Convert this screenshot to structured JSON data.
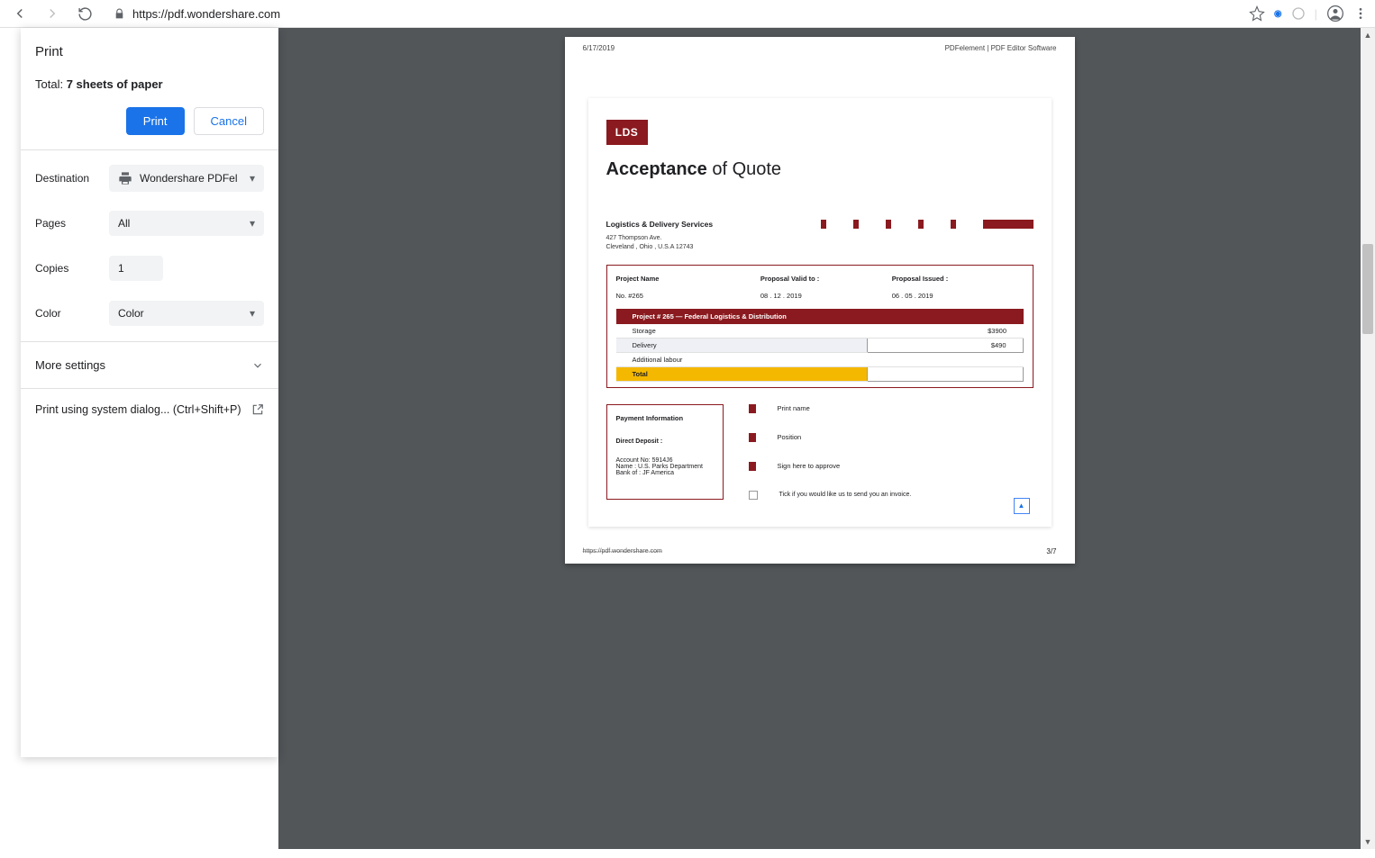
{
  "chrome": {
    "url": "https://pdf.wondershare.com"
  },
  "print": {
    "title": "Print",
    "total_prefix": "Total: ",
    "total_value": "7 sheets of paper",
    "btn_print": "Print",
    "btn_cancel": "Cancel",
    "destination_label": "Destination",
    "destination_value": "Wondershare PDFel",
    "pages_label": "Pages",
    "pages_value": "All",
    "copies_label": "Copies",
    "copies_value": "1",
    "color_label": "Color",
    "color_value": "Color",
    "more_settings": "More settings",
    "system_dialog": "Print using system dialog... (Ctrl+Shift+P)"
  },
  "doc": {
    "header_date": "6/17/2019",
    "header_title": "PDFelement | PDF Editor Software",
    "logo": "LDS",
    "title_bold": "Acceptance",
    "title_rest": " of Quote",
    "company": "Logistics & Delivery Services",
    "addr1": "427 Thompson Ave.",
    "addr2": "Cleveland , Ohio , U.S.A 12743",
    "project_name_label": "Project Name",
    "project_no": "No. #265",
    "valid_label": "Proposal Valid to :",
    "valid_val": "08 . 12 . 2019",
    "issued_label": "Proposal Issued :",
    "issued_val": "06 . 05 . 2019",
    "project_bar": "Project # 265 — Federal Logistics & Distribution",
    "items": {
      "storage_label": "Storage",
      "storage_amt": "$3900",
      "delivery_label": "Delivery",
      "delivery_amt": "$490",
      "labour_label": "Additional labour",
      "total_label": "Total"
    },
    "pay": {
      "title": "Payment Information",
      "dd": "Direct Deposit :",
      "l1": "Account No: 5914J6",
      "l2": "Name :  U.S. Parks Department",
      "l3": "Bank of : JF America"
    },
    "sign": {
      "print_name": "Print name",
      "position": "Position",
      "sign_here": "Sign here to approve",
      "tick": "Tick if you would like us to send you an invoice."
    },
    "footer_link": "https://pdf.wondershare.com",
    "page_num": "3/7"
  }
}
